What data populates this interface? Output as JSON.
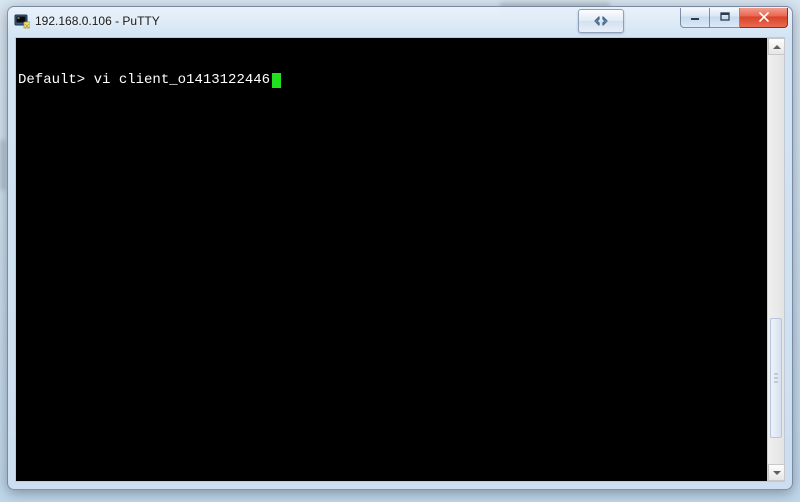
{
  "window": {
    "title": "192.168.0.106 - PuTTY"
  },
  "terminal": {
    "prompt": "Default>",
    "command": "vi client_o1413122446"
  },
  "colors": {
    "cursor": "#20e020",
    "terminal_bg": "#000000",
    "terminal_fg": "#ffffff",
    "close_btn": "#d8422a"
  }
}
